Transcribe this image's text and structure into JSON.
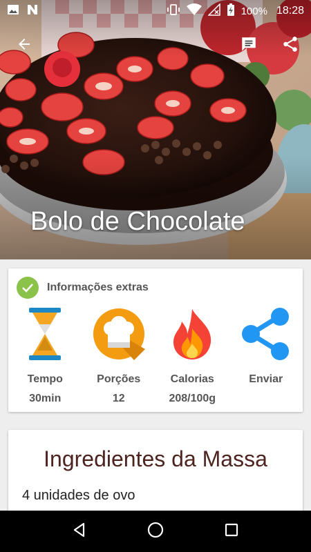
{
  "status_bar": {
    "left_icons": [
      "image-icon",
      "n-logo-icon"
    ],
    "right_icons": [
      "vibrate-icon",
      "wifi-icon",
      "no-signal-icon",
      "battery-charging-icon"
    ],
    "battery": "100%",
    "time": "18:28"
  },
  "app_bar": {
    "back_icon": "arrow-back-icon",
    "comment_icon": "comment-icon",
    "share_icon": "share-icon"
  },
  "recipe": {
    "title": "Bolo de Chocolate"
  },
  "info_card": {
    "title": "Informações extras",
    "items": [
      {
        "icon": "hourglass-icon",
        "label": "Tempo",
        "value": "30min"
      },
      {
        "icon": "chef-hat-icon",
        "label": "Porções",
        "value": "12"
      },
      {
        "icon": "flame-icon",
        "label": "Calorias",
        "value": "208/100g"
      },
      {
        "icon": "share-icon",
        "label": "Enviar",
        "value": ""
      }
    ]
  },
  "ingredients": {
    "title": "Ingredientes da Massa",
    "items": [
      "4 unidades de ovo"
    ]
  },
  "nav_bar": {
    "icons": [
      "back-triangle-icon",
      "home-circle-icon",
      "recents-square-icon"
    ]
  }
}
